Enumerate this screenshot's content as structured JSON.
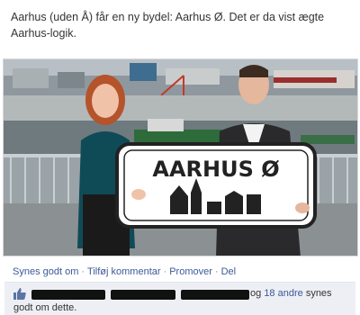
{
  "post": {
    "text": "Aarhus (uden Å) får en ny bydel: Aarhus Ø. Det er da vist ægte Aarhus-logik."
  },
  "photo": {
    "sign_text": "AARHUS Ø"
  },
  "actions": {
    "like": "Synes godt om",
    "comment": "Tilføj kommentar",
    "promote": "Promover",
    "share": "Del"
  },
  "likes": {
    "connector": "og",
    "others_link": "18 andre",
    "suffix": "synes",
    "line2": "godt om dette."
  },
  "colors": {
    "link": "#3b5998",
    "likes_bg": "#edeff4"
  }
}
